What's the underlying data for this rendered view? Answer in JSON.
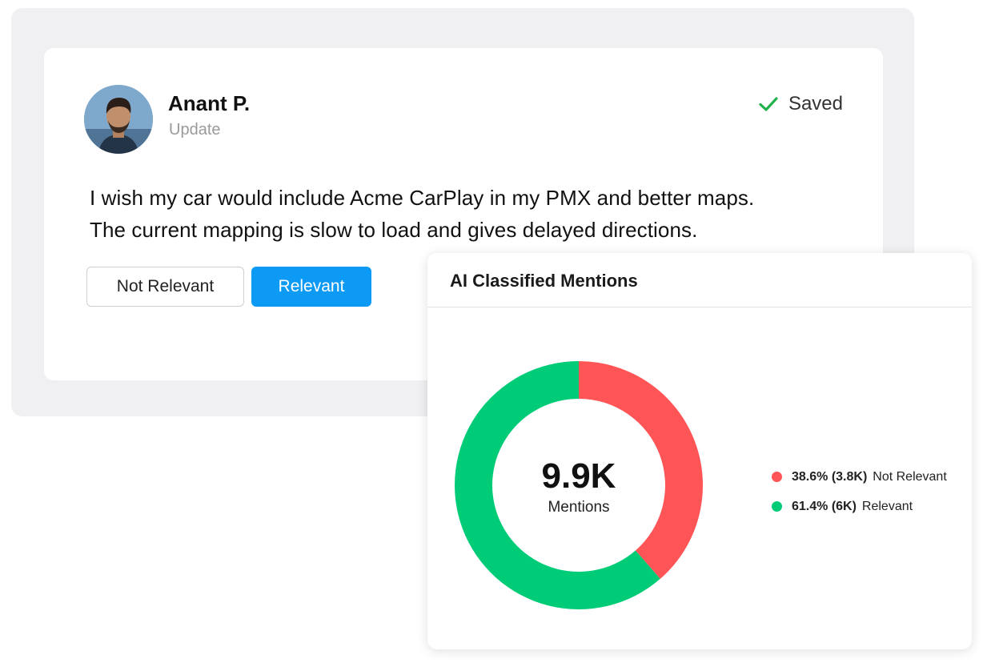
{
  "post": {
    "author_name": "Anant P.",
    "subtitle": "Update",
    "status_label": "Saved",
    "text_line1": "I wish my car would include Acme CarPlay in my PMX and better maps.",
    "text_line2": "The current mapping is slow to load and gives delayed directions.",
    "buttons": {
      "not_relevant": "Not Relevant",
      "relevant": "Relevant"
    }
  },
  "colors": {
    "accent_blue": "#0c9af5",
    "not_relevant_red": "#ff5557",
    "relevant_green": "#00cc78",
    "check_green": "#22b24c"
  },
  "chart_data": {
    "type": "pie",
    "title": "AI Classified Mentions",
    "center_value": "9.9K",
    "center_label": "Mentions",
    "legend_position": "right",
    "series": [
      {
        "name": "Not Relevant",
        "percent": 38.6,
        "value_label": "38.6% (3.8K)",
        "color": "#ff5557"
      },
      {
        "name": "Relevant",
        "percent": 61.4,
        "value_label": "61.4% (6K)",
        "color": "#00cc78"
      }
    ]
  }
}
